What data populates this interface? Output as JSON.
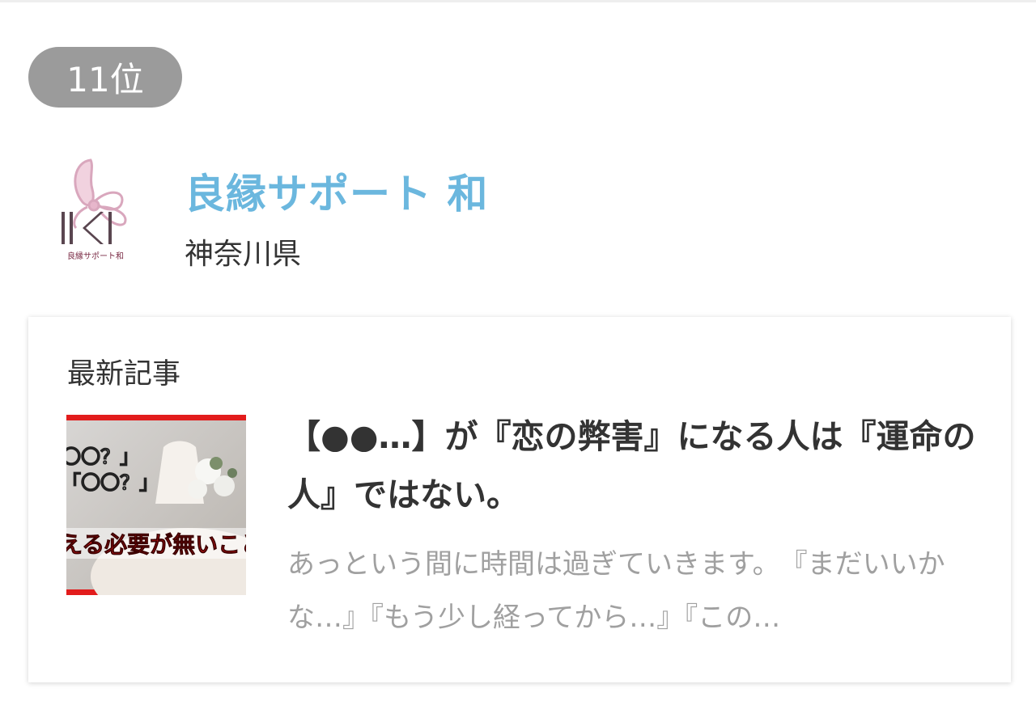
{
  "ranking": {
    "label": "11位"
  },
  "shop": {
    "name": "良縁サポート 和",
    "prefecture": "神奈川県",
    "logo_text": "良縁サポート和",
    "logo_letter": "K"
  },
  "latest": {
    "section_title": "最新記事",
    "article": {
      "thumbnail_texts": [
        "〇〇？」",
        "「〇〇？」",
        "える必要が無いこと"
      ],
      "title": "【●●…】が『恋の弊害』になる人は『運命の人』ではない。",
      "excerpt": "あっという間に時間は過ぎていきます。　『まだいいかな…』『もう少し経ってから…』『この…"
    }
  },
  "colors": {
    "accent": "#6bb7de",
    "badge": "#9b9b9b",
    "thumb_border": "#e21c1c"
  }
}
